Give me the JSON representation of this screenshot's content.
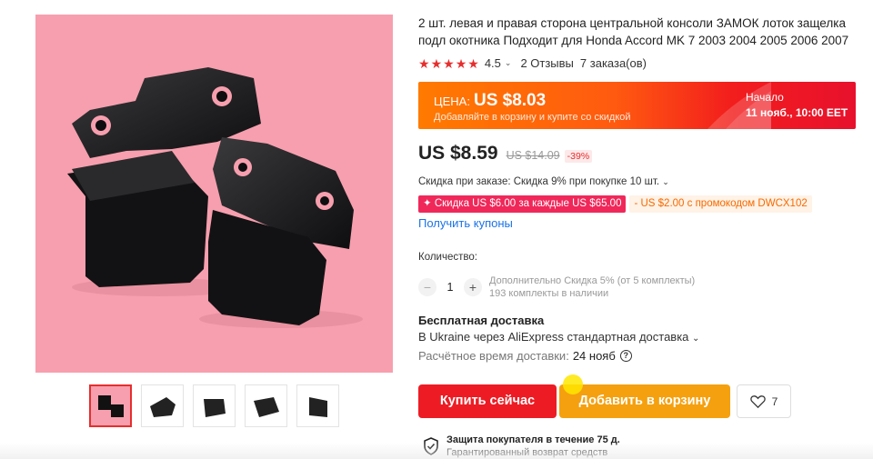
{
  "product": {
    "title": "2 шт. левая и правая сторона центральной консоли ЗАМОК лоток защелка подл окотника Подходит для Honda Accord MK 7 2003 2004 2005 2006 2007",
    "rating": "4.5",
    "reviews": "2 Отзывы",
    "orders": "7 заказа(ов)",
    "stars_filled": 5
  },
  "promo": {
    "price_label": "ЦЕНА:",
    "price": "US $8.03",
    "subtitle": "Добавляйте в корзину и купите со скидкой",
    "start_label": "Начало",
    "start_date": "11 нояб., 10:00 EET",
    "colors": {
      "start": "#ff7a00",
      "end": "#e8112d"
    }
  },
  "pricing": {
    "price": "US $8.59",
    "old_price": "US $14.09",
    "discount": "-39%"
  },
  "discounts": {
    "order_discount": "Скидка при заказе: Скидка 9% при покупке 10 шт.",
    "coupon_store": "✦ Скидка US $6.00 за каждые US $65.00",
    "coupon_code": "- US $2.00 с промокодом DWCX102",
    "get_coupons": "Получить купоны"
  },
  "quantity": {
    "label": "Количество:",
    "value": "1",
    "minus": "−",
    "plus": "+",
    "extra_discount": "Дополнительно Скидка 5% (от 5 комплекты)",
    "stock": "193 комплекты в наличии"
  },
  "shipping": {
    "title": "Бесплатная доставка",
    "via": "В Ukraine через AliExpress стандартная доставка",
    "time_label": "Расчётное время доставки:",
    "time_value": "24 нояб",
    "help": "?"
  },
  "actions": {
    "buy_now": "Купить сейчас",
    "add_to_cart": "Добавить в корзину",
    "wishlist_count": "7",
    "accent_red": "#ed1c24",
    "accent_orange": "#f5a00f"
  },
  "protection": {
    "title": "Защита покупателя в течение 75 д.",
    "subtitle": "Гарантированный возврат средств"
  },
  "gallery": {
    "thumb_count": 5,
    "active_index": 0,
    "background": "#f79fae"
  }
}
